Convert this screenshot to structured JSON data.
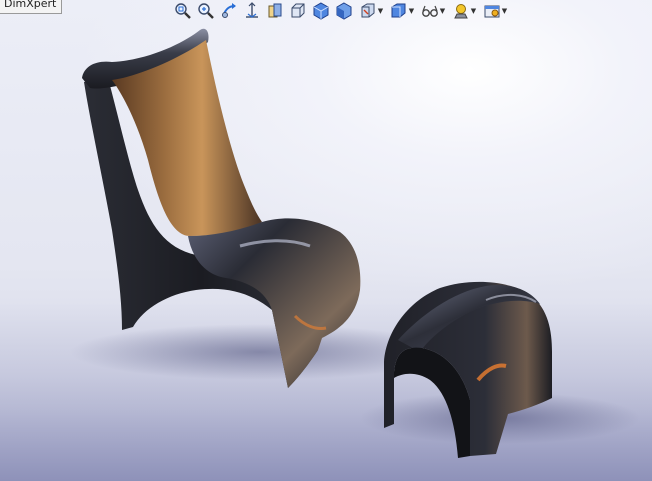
{
  "window": {
    "tab_label": "DimXpert"
  },
  "toolbar": {
    "items": [
      {
        "icon": "zoom-to-fit-icon",
        "has_dropdown": false
      },
      {
        "icon": "zoom-to-area-icon",
        "has_dropdown": false
      },
      {
        "icon": "previous-view-icon",
        "has_dropdown": false
      },
      {
        "icon": "section-view-icon",
        "has_dropdown": false
      },
      {
        "icon": "dynamic-annotation-icon",
        "has_dropdown": false
      },
      {
        "icon": "view-orientation-icon",
        "has_dropdown": false
      },
      {
        "icon": "isometric-view-icon",
        "has_dropdown": false
      },
      {
        "icon": "shaded-view-icon",
        "has_dropdown": false
      },
      {
        "icon": "display-style-icon",
        "has_dropdown": true
      },
      {
        "icon": "hide-show-items-icon",
        "has_dropdown": true
      },
      {
        "icon": "edit-appearance-icon",
        "has_dropdown": true
      },
      {
        "icon": "apply-scene-icon",
        "has_dropdown": true
      },
      {
        "icon": "view-settings-icon",
        "has_dropdown": true
      }
    ]
  },
  "scene": {
    "objects": [
      "lounge-chair-model",
      "ottoman-model"
    ],
    "colors": {
      "body": "#23252c",
      "highlight": "#9aa0b4",
      "wood_reflection": "#9a6a3a",
      "background_top": "#ffffff",
      "floor": "#8a8db8"
    }
  }
}
